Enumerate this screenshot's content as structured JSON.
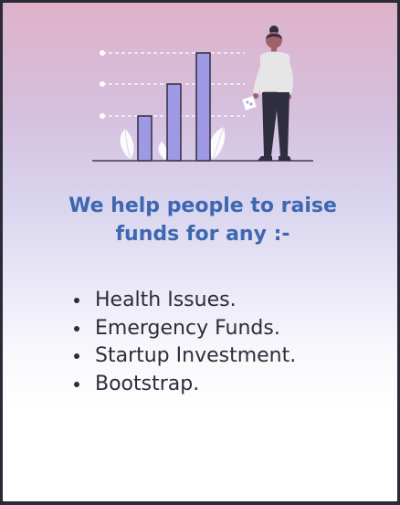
{
  "headline": {
    "line1": "We help people to raise",
    "line2": "funds for any :-"
  },
  "purposes": [
    "Health Issues.",
    "Emergency Funds.",
    "Startup Investment.",
    "Bootstrap."
  ],
  "colors": {
    "headline": "#3e67b1",
    "text": "#2d2d3a",
    "bar": "#9f99e3",
    "figure": "#2f2e41",
    "border": "#2b2b38"
  },
  "illustration": {
    "icon": "person-with-growth-chart-illustration"
  }
}
